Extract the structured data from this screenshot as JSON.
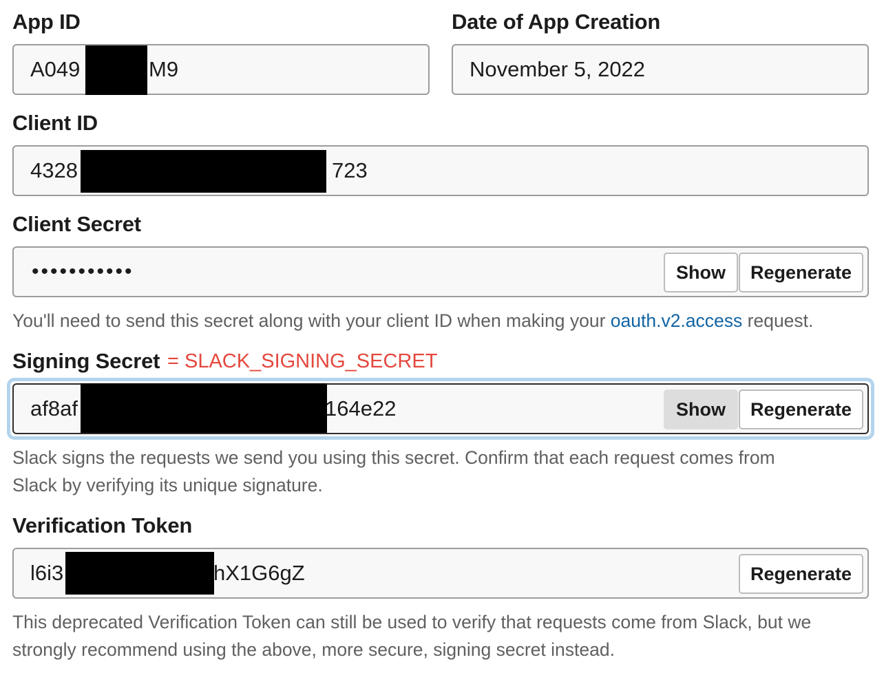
{
  "app_id": {
    "label": "App ID",
    "value_start": "A049",
    "value_end": "M9"
  },
  "date_created": {
    "label": "Date of App Creation",
    "value": "November 5, 2022"
  },
  "client_id": {
    "label": "Client ID",
    "value_start": "4328",
    "value_end": "723"
  },
  "client_secret": {
    "label": "Client Secret",
    "value": "•••••••••••",
    "show_label": "Show",
    "regenerate_label": "Regenerate",
    "help_before": "You'll need to send this secret along with your client ID when making your ",
    "help_link": "oauth.v2.access",
    "help_after": " request."
  },
  "signing_secret": {
    "label": "Signing Secret",
    "annotation": "= SLACK_SIGNING_SECRET",
    "value_start": "af8af",
    "value_end": "164e22",
    "show_label": "Show",
    "regenerate_label": "Regenerate",
    "help_line1": "Slack signs the requests we send you using this secret. Confirm that each request comes from",
    "help_line2": "Slack by verifying its unique signature."
  },
  "verification_token": {
    "label": "Verification Token",
    "value_start": "l6i3",
    "value_end": "hX1G6gZ",
    "regenerate_label": "Regenerate",
    "help_line1": "This deprecated Verification Token can still be used to verify that requests come from Slack, but we",
    "help_line2": "strongly recommend using the above, more secure, signing secret instead."
  },
  "colors": {
    "annotation": "#e4473d",
    "link": "#1264a3",
    "focus_ring": "#b3d4ec",
    "redaction": "#000000"
  }
}
